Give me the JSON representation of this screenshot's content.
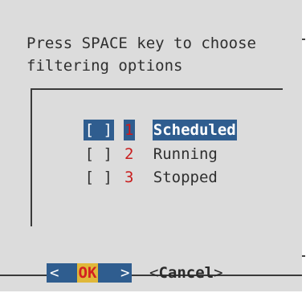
{
  "prompt": {
    "line1": "Press SPACE key to choose",
    "line2": "filtering options"
  },
  "options": [
    {
      "checkbox": "[ ]",
      "number": "1",
      "label": "Scheduled",
      "selected": true
    },
    {
      "checkbox": "[ ]",
      "number": "2",
      "label": "Running",
      "selected": false
    },
    {
      "checkbox": "[ ]",
      "number": "3",
      "label": "Stopped",
      "selected": false
    }
  ],
  "buttons": {
    "ok_left": "<",
    "ok_label": "OK",
    "ok_right": ">",
    "cancel_left": "<",
    "cancel_label": "Cancel",
    "cancel_right": ">"
  },
  "colors": {
    "dialog_bg": "#dcdcdc",
    "selection_bg": "#2f5d8f",
    "number_red": "#c81e1e",
    "ok_highlight": "#e0b83a"
  }
}
